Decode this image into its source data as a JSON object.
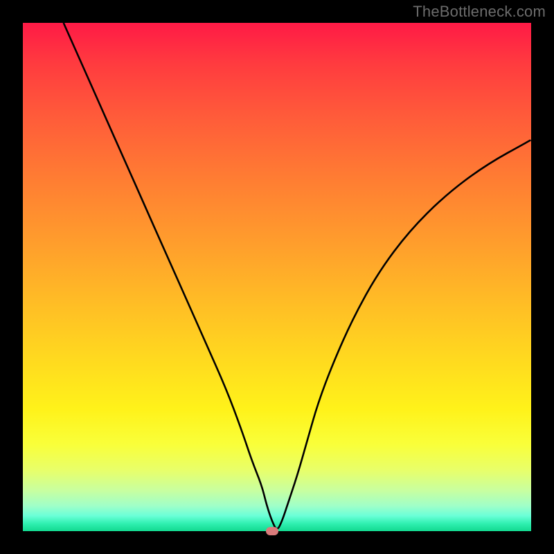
{
  "watermark": "TheBottleneck.com",
  "chart_data": {
    "type": "line",
    "title": "",
    "xlabel": "",
    "ylabel": "",
    "xlim": [
      0,
      100
    ],
    "ylim": [
      0,
      100
    ],
    "grid": false,
    "legend": false,
    "background_gradient": {
      "top": "#ff1a46",
      "bottom": "#12d990",
      "direction": "vertical"
    },
    "series": [
      {
        "name": "bottleneck-curve",
        "color": "#000000",
        "x": [
          8,
          12,
          16,
          20,
          24,
          28,
          32,
          36,
          40,
          43,
          45,
          47,
          48,
          49,
          50,
          51,
          52,
          54,
          56,
          58,
          61,
          65,
          70,
          76,
          83,
          91,
          100
        ],
        "y": [
          100,
          91,
          82,
          73,
          64,
          55,
          46,
          37,
          28,
          20,
          14,
          9,
          5,
          2,
          0,
          2,
          5,
          11,
          18,
          25,
          33,
          42,
          51,
          59,
          66,
          72,
          77
        ]
      }
    ],
    "marker": {
      "name": "target-point",
      "x": 49,
      "y": 0,
      "color": "#d97b7b"
    }
  }
}
